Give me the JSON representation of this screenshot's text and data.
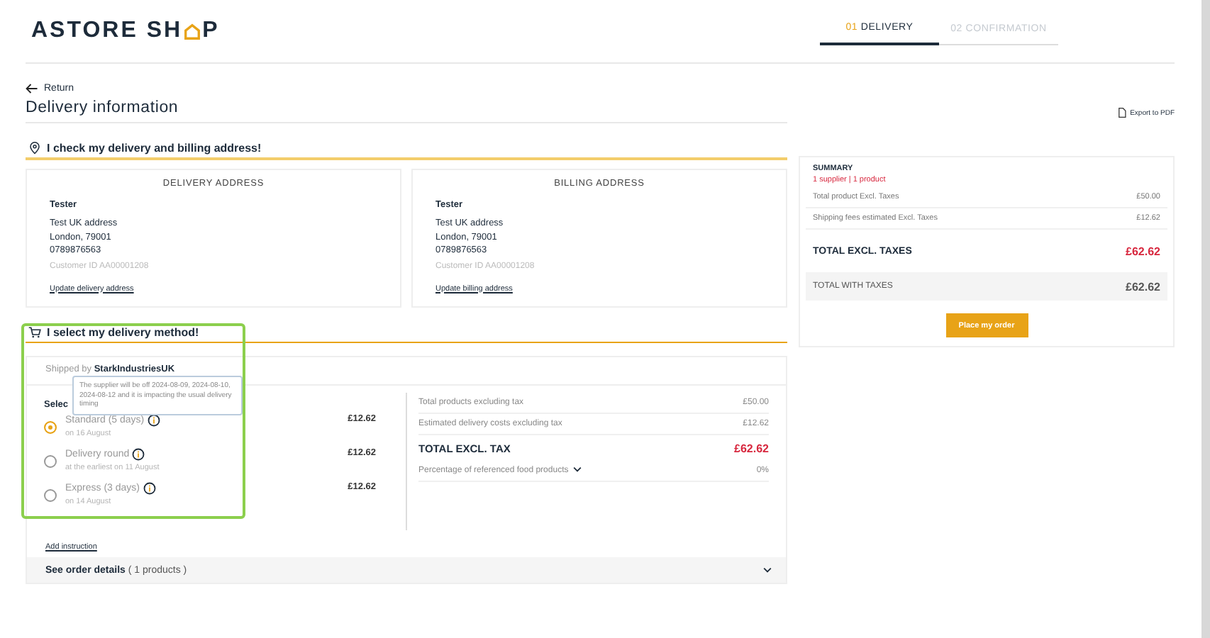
{
  "header": {
    "logo": {
      "before": "ASTORE SH",
      "after": "P"
    },
    "steps": [
      {
        "number": "01",
        "label": "DELIVERY",
        "selected": true
      },
      {
        "number": "02",
        "label": "CONFIRMATION",
        "selected": false
      }
    ]
  },
  "return_link": "Return",
  "title": "Delivery information",
  "export_link": "Export to PDF",
  "address_section": {
    "heading": "I check my delivery and billing address!",
    "cards": [
      {
        "title": "DELIVERY ADDRESS",
        "name": "Tester",
        "lines": [
          "Test UK address",
          "London, 79001",
          "0789876563"
        ],
        "customer_id": "Customer ID AA00001208",
        "link": "Update delivery address"
      },
      {
        "title": "BILLING ADDRESS",
        "name": "Tester",
        "lines": [
          "Test UK address",
          "London, 79001",
          "0789876563"
        ],
        "customer_id": "Customer ID AA00001208",
        "link": "Update billing address"
      }
    ]
  },
  "delivery_section": {
    "heading": "I select my delivery method!",
    "shipped_by_label": "Shipped by",
    "supplier": "StarkIndustriesUK",
    "select_label": "Selec",
    "tooltip": "The supplier will be off 2024-08-09, 2024-08-10, 2024-08-12 and it is impacting the usual delivery timing",
    "options": [
      {
        "label": "Standard (5 days)",
        "date": "on 16 August",
        "price": "£12.62",
        "selected": true
      },
      {
        "label": "Delivery round",
        "date": "at the earliest on 11 August",
        "price": "£12.62",
        "selected": false
      },
      {
        "label": "Express (3 days)",
        "date": "on 14 August",
        "price": "£12.62",
        "selected": false
      }
    ],
    "totals": [
      {
        "label": "Total products excluding tax",
        "value": "£50.00",
        "kind": "line"
      },
      {
        "label": "Estimated delivery costs excluding tax",
        "value": "£12.62",
        "kind": "line"
      },
      {
        "label": "TOTAL EXCL. TAX",
        "value": "£62.62",
        "kind": "total"
      },
      {
        "label": "Percentage of referenced food products",
        "value": "0%",
        "kind": "dropdown"
      }
    ],
    "add_instruction": "Add instruction",
    "order_details": "See order details",
    "order_count": "( 1 products )"
  },
  "summary": {
    "title": "SUMMARY",
    "subtitle": "1 supplier | 1 product",
    "lines": [
      {
        "label": "Total product Excl. Taxes",
        "value": "£50.00",
        "kind": "line"
      },
      {
        "label": "Shipping fees estimated Excl. Taxes",
        "value": "£12.62",
        "kind": "line"
      },
      {
        "label": "TOTAL EXCL. TAXES",
        "value": "£62.62",
        "kind": "total"
      },
      {
        "label": "TOTAL WITH TAXES",
        "value": "£62.62",
        "kind": "grand"
      }
    ],
    "button": "Place my order"
  }
}
